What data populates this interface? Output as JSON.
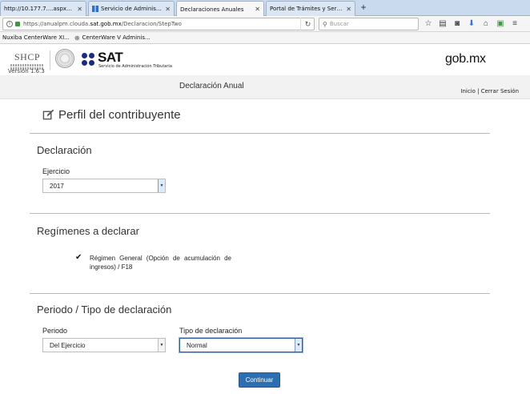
{
  "browser": {
    "tabs": [
      {
        "label": "http://10.177.7....aspx?remote=0#",
        "active": false
      },
      {
        "label": "Servicio de Administración...",
        "active": false
      },
      {
        "label": "Declaraciones Anuales",
        "active": true
      },
      {
        "label": "Portal de Trámites y Servicios a...",
        "active": false
      }
    ],
    "new_tab": "+",
    "url_prefix": "https://anualpm.clouda.",
    "url_domain": "sat.gob.mx",
    "url_suffix": "/Declaracion/StepTwo",
    "search_placeholder": "Buscar",
    "bookmarks": [
      {
        "label": "Nuxiba CenterWare XI..."
      },
      {
        "label": "CenterWare V Adminis..."
      }
    ]
  },
  "header": {
    "shcp": "SHCP",
    "version": "Versión 1.6.3",
    "sat": "SAT",
    "sat_sub": "Servicio de Administración Tributaria",
    "gobmx": "gob.mx",
    "subtitle": "Declaración Anual",
    "links": {
      "inicio": "Inicio",
      "separator": " | ",
      "cerrar": "Cerrar Sesión"
    }
  },
  "page_title": "Perfil del contribuyente",
  "declaracion": {
    "title": "Declaración",
    "ejercicio_label": "Ejercicio",
    "ejercicio_value": "2017"
  },
  "regimenes": {
    "title": "Regímenes a declarar",
    "items": [
      {
        "label": "Régimen General (Opción de acumulación de ingresos) / F18",
        "checked": true
      }
    ]
  },
  "periodo": {
    "title": "Periodo / Tipo de declaración",
    "periodo_label": "Periodo",
    "periodo_value": "Del Ejercicio",
    "tipo_label": "Tipo de declaración",
    "tipo_value": "Normal"
  },
  "continuar_label": "Continuar",
  "colors": {
    "primary_button": "#2d6eb0",
    "sat_blue": "#1a2a86",
    "focus_border": "#2f5ea8"
  }
}
